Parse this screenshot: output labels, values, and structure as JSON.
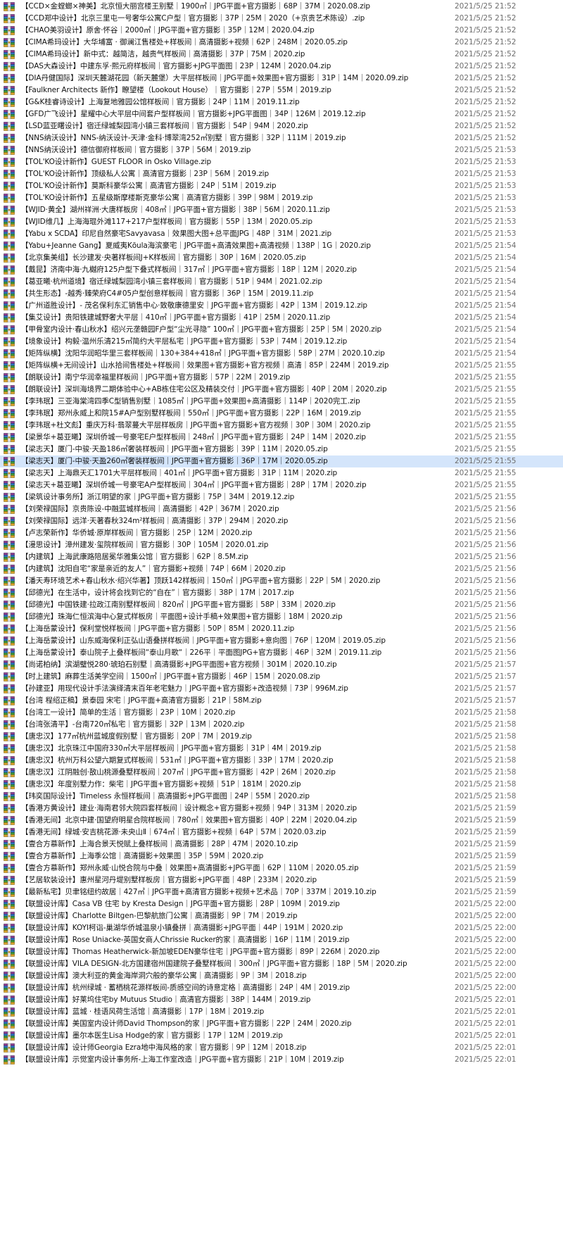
{
  "icon": "rar-archive-icon",
  "colors": {
    "selected_row": "#d4e5fb",
    "date_text": "#6d6d6d"
  },
  "selected_index": 38,
  "files": [
    {
      "name": "【CCD×金螳螂×神美】北京恒大丽宫楼王别墅｜1900㎡｜JPG平面+官方摄影｜68P｜37M｜2020.08.zip",
      "date": "2021/5/25 21:52"
    },
    {
      "name": "【CCD郑中设计】北京三里屯一号奢华公寓C户型｜官方摄影｜37P｜25M｜2020（+京贵艺术陈设）.zip",
      "date": "2021/5/25 21:52"
    },
    {
      "name": "【CHAO美羽设计】原舍·怀谷｜2000㎡｜JPG平面+官方摄影｜35P｜12M｜2020.04.zip",
      "date": "2021/5/25 21:52"
    },
    {
      "name": "【CIMA希玛设计】大华埔富 · 御澜江售楼处+样板间｜高清摄影+视频｜62P｜248M｜2020.05.zip",
      "date": "2021/5/25 21:52"
    },
    {
      "name": "【CIMA希玛设计】新中式：越简洁，越贵气样板间｜高清摄影｜37P｜75M｜2020.zip",
      "date": "2021/5/25 21:52"
    },
    {
      "name": "【DAS大森设计】中建东孚·熙元府样板间｜官方摄影+JPG平面图｜23P｜124M｜2020.04.zip",
      "date": "2021/5/25 21:52"
    },
    {
      "name": "【DIA丹健国际】深圳天麓湖花园（新天麓堡）大平层样板间｜JPG平面+效果图+官方摄影｜31P｜14M｜2020.09.zip",
      "date": "2021/5/25 21:52"
    },
    {
      "name": "【Faulkner Architects 新作】瞭望楼（Lookout House）｜官方摄影｜27P｜55M｜2019.zip",
      "date": "2021/5/25 21:52"
    },
    {
      "name": "【G&K桂睿诗设计】上海复地雅园公馆样板间｜官方摄影｜24P｜11M｜2019.11.zip",
      "date": "2021/5/25 21:52"
    },
    {
      "name": "【GFD广飞设计】星耀中心大平层中间套户型样板间｜官方摄影+JPG平面图｜34P｜126M｜2019.12.zip",
      "date": "2021/5/25 21:52"
    },
    {
      "name": "【LSD蓝亚曙设计】宿迁绿城梨园湾小镇三套样板间｜官方摄影｜54P｜94M｜2020.zip",
      "date": "2021/5/25 21:52"
    },
    {
      "name": "【NNS纳沃设计】NNS-纳沃设计-天津·金科·博翠湾252㎡别墅｜官方摄影｜32P｜111M｜2019.zip",
      "date": "2021/5/25 21:52"
    },
    {
      "name": "【NNS纳沃设计】德信御府样板间｜官方摄影｜37P｜56M｜2019.zip",
      "date": "2021/5/25 21:53"
    },
    {
      "name": "【TOL'KO设计新作】GUEST FLOOR in Osko Village.zip",
      "date": "2021/5/25 21:53"
    },
    {
      "name": "【TOL'KO设计新作】顶级私人公寓｜高清官方摄影｜23P｜56M｜2019.zip",
      "date": "2021/5/25 21:53"
    },
    {
      "name": "【TOL'KO设计新作】莫斯科豪华公寓｜高清官方摄影｜24P｜51M｜2019.zip",
      "date": "2021/5/25 21:53"
    },
    {
      "name": "【TOL'KO设计新作】五星级斯摩楼斯克豪华公寓｜高清官方摄影｜39P｜98M｜2019.zip",
      "date": "2021/5/25 21:53"
    },
    {
      "name": "【WJID·黄全】湖州祥洲·大唐样板房｜408㎡｜JPG平面+官方摄影｜38P｜56M｜2020.11.zip",
      "date": "2021/5/25 21:53"
    },
    {
      "name": "【WJID维几】上海海琨外滩117+217户型样板间｜官方摄影｜55P｜13M｜2020.05.zip",
      "date": "2021/5/25 21:53"
    },
    {
      "name": "【Yabu x SCDA】印尼自然豪宅Savyavasa｜效果图大图+总平面JPG｜48P｜31M｜2021.zip",
      "date": "2021/5/25 21:53"
    },
    {
      "name": "【Yabu+Jeanne Gang】夏威夷Kōula海滨豪宅｜JPG平面+高清效果图+高清视频｜138P｜1G｜2020.zip",
      "date": "2021/5/25 21:54"
    },
    {
      "name": "【北京集美组】长沙建发·央著样板间J+K样板间｜官方摄影｜30P｜16M｜2020.05.zip",
      "date": "2021/5/25 21:54"
    },
    {
      "name": "【戴昆】济南中海·九樾府125户型下叠式样板间｜317㎡｜JPG平面+官方摄影｜18P｜12M｜2020.zip",
      "date": "2021/5/25 21:54"
    },
    {
      "name": "【葛亚曦·杭州道境】宿迁绿城梨园湾小镇三套样板间｜官方摄影｜51P｜94M｜2021.02.zip",
      "date": "2021/5/25 21:54"
    },
    {
      "name": "【共生形态】-越秀·臻荣府C4#05户型创意样板间｜官方摄影｜36P｜15M｜2019.11.zip",
      "date": "2021/5/25 21:54"
    },
    {
      "name": "【广州道胜设计】- 茂名保利东汇销售中心·致敬康德里安｜JPG平面+官方摄影｜42P｜13M｜2019.12.zip",
      "date": "2021/5/25 21:54"
    },
    {
      "name": "【集艾设计】贵阳铁建城野奢大平层｜410㎡｜JPG平面+官方摄影｜41P｜25M｜2020.11.zip",
      "date": "2021/5/25 21:54"
    },
    {
      "name": "【甲骨室内设计·春山秋水】绍兴元垄赣园F户型“尘光寻隐” 100㎡｜JPG平面+官方摄影｜25P｜5M｜2020.zip",
      "date": "2021/5/25 21:54"
    },
    {
      "name": "【境象设计】构毅·温州乐清215㎡简约大平层私宅｜JPG平面+官方摄影｜53P｜74M｜2019.12.zip",
      "date": "2021/5/25 21:54"
    },
    {
      "name": "【矩阵纵横】沈阳华润昭华里三套样板间｜130+384+418㎡｜JPG平面+官方摄影｜58P｜27M｜2020.10.zip",
      "date": "2021/5/25 21:54"
    },
    {
      "name": "【矩阵纵横+无间设计】山水拾间售楼处+样板间｜效果图+官方摄影+官方视频｜高清｜85P｜224M｜2019.zip",
      "date": "2021/5/25 21:55"
    },
    {
      "name": "【朗联设计】南宁华润幸福里样板间｜JPG平面+官方摄影｜57P｜22M｜2019.zip",
      "date": "2021/5/25 21:55"
    },
    {
      "name": "【朗联设计】深圳海境界二期体验中心+AB栋住宅公区及精装交付｜JPG平面+官方摄影｜40P｜20M｜2020.zip",
      "date": "2021/5/25 21:55"
    },
    {
      "name": "【李玮珉】三亚海棠湾四季C型销售别墅｜1085㎡｜JPG平面+效果图+高清摄影｜114P｜2020完工.zip",
      "date": "2021/5/25 21:55"
    },
    {
      "name": "【李玮珉】郑州永威上和院15#A户型别墅样板间｜550㎡｜JPG平面+官方摄影｜22P｜16M｜2019.zip",
      "date": "2021/5/25 21:55"
    },
    {
      "name": "【李玮珉+杜文彪】重庆万科·翡翠蔓大平层样板房｜JPG平面+官方摄影+官方视频｜30P｜30M｜2020.zip",
      "date": "2021/5/25 21:55"
    },
    {
      "name": "【梁景华+葛亚曦】深圳侨城一号豪宅E户型样板间｜248㎡｜JPG平面+官方摄影｜24P｜14M｜2020.zip",
      "date": "2021/5/25 21:55"
    },
    {
      "name": "【梁志天】厦门-中骏·天盈186㎡奢装样板间｜JPG平面+官方摄影｜39P｜11M｜2020.05.zip",
      "date": "2021/5/25 21:55"
    },
    {
      "name": "【梁志天】厦门-中骏·天盈260㎡奢装样板间｜JPG平面+官方摄影｜36P｜17M｜2020.05.zip",
      "date": "2021/5/25 21:55"
    },
    {
      "name": "【梁志天】上海鼎天汇1701大平层样板间｜401㎡｜JPG平面+官方摄影｜31P｜11M｜2020.zip",
      "date": "2021/5/25 21:55"
    },
    {
      "name": "【梁志天+葛亚曦】深圳侨城一号豪宅A户型样板间｜304㎡｜JPG平面+官方摄影｜28P｜17M｜2020.zip",
      "date": "2021/5/25 21:55"
    },
    {
      "name": "【梁筑设计事务所】浙江明望的家｜JPG平面+官方摄影｜75P｜34M｜2019.12.zip",
      "date": "2021/5/25 21:55"
    },
    {
      "name": "【刘荣禄国际】京贵陈设-中融蓝城样板间｜高清摄影｜42P｜367M｜2020.zip",
      "date": "2021/5/25 21:56"
    },
    {
      "name": "【刘荣禄国际】远洋·天著春秋324m²样板间｜高清摄影｜37P｜294M｜2020.zip",
      "date": "2021/5/25 21:56"
    },
    {
      "name": "【卢志荣新作】华侨城·原岸样板间｜官方摄影｜25P｜12M｜2020.zip",
      "date": "2021/5/25 21:56"
    },
    {
      "name": "【漫思设计】漳州建发·玺院样板间｜官方摄影｜30P｜105M｜2020.01.zip",
      "date": "2021/5/25 21:56"
    },
    {
      "name": "【内建筑】上海武康路陪居冕华雅集公馆｜官方摄影｜62P｜8.5M.zip",
      "date": "2021/5/25 21:56"
    },
    {
      "name": "【内建筑】沈阳自宅“家是亲近的友人”｜官方摄影+视频｜74P｜66M｜2020.zip",
      "date": "2021/5/25 21:56"
    },
    {
      "name": "【潘天寿环境艺术+春山秋水·绍兴华著】顶跃142样板间｜150㎡｜JPG平面+官方摄影｜22P｜5M｜2020.zip",
      "date": "2021/5/25 21:56"
    },
    {
      "name": "【邱德光】在生活中，设计将会找到它的“自在”｜官方摄影｜38P｜17M｜2017.zip",
      "date": "2021/5/25 21:56"
    },
    {
      "name": "【邱德光】中国铁建·拉政江南别墅样板间｜820㎡｜JPG平面+官方摄影｜58P｜33M｜2020.zip",
      "date": "2021/5/25 21:56"
    },
    {
      "name": "【邱德光】珠海仁恒滨海中心复式样板房｜平面图+设计手稿+效果图+官方摄影｜18M｜2020.zip",
      "date": "2021/5/25 21:56"
    },
    {
      "name": "【上海岳蒙设计】保利堂悦样板间｜JPG平面+官方摄影｜50P｜85M｜2020.11.zip",
      "date": "2021/5/25 21:56"
    },
    {
      "name": "【上海岳蒙设计】山东威海保利正弘山语叠拼样板间｜JPG平面+官方摄影+意向图｜76P｜120M｜2019.05.zip",
      "date": "2021/5/25 21:56"
    },
    {
      "name": "【上海岳蒙设计】泰山院子上叠样板间“泰山月歌“｜226平｜平面图JPG+官方摄影｜46P｜32M｜2019.11.zip",
      "date": "2021/5/25 21:56"
    },
    {
      "name": "【尚诺柏纳】滨湖璧悦280·琥珀石别墅｜高清摄影+JPG平面图+官方视频｜301M｜2020.10.zip",
      "date": "2021/5/25 21:57"
    },
    {
      "name": "【时上建筑】麻葬生活美学空间｜1500㎡｜JPG平面+官方摄影｜46P｜15M｜2020.08.zip",
      "date": "2021/5/25 21:57"
    },
    {
      "name": "【孙建亚】用现代设计手法演绎清末百年老宅魅力｜JPG平面+官方摄影+改造视频｜73P｜996M.zip",
      "date": "2021/5/25 21:57"
    },
    {
      "name": "【台湾 程绍正稿】景泰园 宋宅｜JPG平面+高清官方摄影｜21P｜58M.zip",
      "date": "2021/5/25 21:57"
    },
    {
      "name": "【台湾工一设计】简单的生活｜官方摄影｜23P｜10M｜2020.zip",
      "date": "2021/5/25 21:58"
    },
    {
      "name": "【台湾张清平】-台南720㎡私宅｜官方摄影｜32P｜13M｜2020.zip",
      "date": "2021/5/25 21:58"
    },
    {
      "name": "【唐忠汉】177㎡杭州蓝城度假别墅｜官方摄影｜20P｜7M｜2019.zip",
      "date": "2021/5/25 21:58"
    },
    {
      "name": "【唐忠汉】北京珠江中国府330㎡大平层样板间｜JPG平面+官方摄影｜31P｜4M｜2019.zip",
      "date": "2021/5/25 21:58"
    },
    {
      "name": "【唐忠汉】杭州万科公望六期复式样板间｜531㎡｜JPG平面+官方摄影｜33P｜17M｜2020.zip",
      "date": "2021/5/25 21:58"
    },
    {
      "name": "【唐忠汉】江阴融创·敔山桃源叠墅样板间｜207㎡｜JPG平面+官方摄影｜42P｜26M｜2020.zip",
      "date": "2021/5/25 21:58"
    },
    {
      "name": "【唐忠汉】年度别墅力作：柴宅｜JPG平面+官方摄影+视频｜51P｜181M｜2020.zip",
      "date": "2021/5/25 21:58"
    },
    {
      "name": "【玮奕国际设计】Timeless 永恒样板间｜高清摄影+JPG平面图｜24P｜55M｜2020.zip",
      "date": "2021/5/25 21:58"
    },
    {
      "name": "【香港方黄设计】建业·海南君邻大院四套样板间｜设计概念+官方摄影+视频｜94P｜313M｜2020.zip",
      "date": "2021/5/25 21:59"
    },
    {
      "name": "【香港无间】北京中建·国望府明星合院样板间｜780㎡｜效果图+官方摄影｜40P｜22M｜2020.04.zip",
      "date": "2021/5/25 21:59"
    },
    {
      "name": "【香港无间】绿城·安吉桃花源·未央山Ⅱ｜674㎡｜官方摄影+视频｜64P｜57M｜2020.03.zip",
      "date": "2021/5/25 21:59"
    },
    {
      "name": "【壹合方慕新作】上海合景天悦赋上叠样板间｜高清摄影｜28P｜47M｜2020.10.zip",
      "date": "2021/5/25 21:59"
    },
    {
      "name": "【壹合方慕新作】上海季公馆｜高清摄影+效果图｜35P｜59M｜2020.zip",
      "date": "2021/5/25 21:59"
    },
    {
      "name": "【壹合方慕新作】郑州永威·山悦合院与中叠｜效果图+高清摄影+JPG平面｜62P｜110M｜2020.05.zip",
      "date": "2021/5/25 21:59"
    },
    {
      "name": "【艺居软装设计】惠州星河丹堤别墅样板房｜官方摄影+JPG平面｜48P｜233M｜2020.zip",
      "date": "2021/5/25 21:59"
    },
    {
      "name": "【最新私宅】贝聿铭纽约故居｜427㎡｜JPG平面+高清官方摄影+视频+艺术品｜70P｜337M｜2019.10.zip",
      "date": "2021/5/25 21:59"
    },
    {
      "name": "【联盟设计库】Casa VB 住宅 by Kresta Design｜JPG平面+官方摄影｜28P｜109M｜2019.zip",
      "date": "2021/5/25 22:00"
    },
    {
      "name": "【联盟设计库】Charlotte Biltgen-巴黎航旅门公寓｜高清摄影｜9P｜7M｜2019.zip",
      "date": "2021/5/25 22:00"
    },
    {
      "name": "【联盟设计库】KOYI柯诣-巢湖华侨城温泉小镇叠拼｜高清摄影+JPG平面｜44P｜191M｜2020.zip",
      "date": "2021/5/25 22:00"
    },
    {
      "name": "【联盟设计库】Rose Uniacke-英国女商人Chrissie Rucker的家｜高清摄影｜16P｜11M｜2019.zip",
      "date": "2021/5/25 22:00"
    },
    {
      "name": "【联盟设计库】Thomas Heatherwick-新加坡EDEN豪华住宅｜JPG平面+官方摄影｜89P｜226M｜2020.zip",
      "date": "2021/5/25 22:00"
    },
    {
      "name": "【联盟设计库】VILA DESIGN-北方国建宿州国建院子叠墅样板间｜300㎡｜JPG平面+官方摄影｜18P｜5M｜2020.zip",
      "date": "2021/5/25 22:00"
    },
    {
      "name": "【联盟设计库】澳大利亚的黄金海岸洞穴般的豪华公寓｜高清摄影｜9P｜3M｜2018.zip",
      "date": "2021/5/25 22:00"
    },
    {
      "name": "【联盟设计库】杭州绿城 · 蓄栖桃花源样板间-质感空间的诗意定格｜高清摄影｜24P｜4M｜2019.zip",
      "date": "2021/5/25 22:00"
    },
    {
      "name": "【联盟设计库】好莱坞住宅by Mutuus Studio｜高清官方摄影｜38P｜144M｜2019.zip",
      "date": "2021/5/25 22:01"
    },
    {
      "name": "【联盟设计库】蓝城 · 桂语风荷生活馆｜高清摄影｜17P｜18M｜2019.zip",
      "date": "2021/5/25 22:01"
    },
    {
      "name": "【联盟设计库】美国室内设计师David Thompson的家｜JPG平面+官方摄影｜22P｜24M｜2020.zip",
      "date": "2021/5/25 22:01"
    },
    {
      "name": "【联盟设计库】墨尔本医生Lisa Hodge的家｜官方摄影｜17P｜12M｜2019.zip",
      "date": "2021/5/25 22:01"
    },
    {
      "name": "【联盟设计库】设计师Georgia Ezra地中海风格的家｜官方摄影｜9P｜12M｜2018.zip",
      "date": "2021/5/25 22:01"
    },
    {
      "name": "【联盟设计库】示觉室内设计事务所-上海工作室改造｜JPG平面+官方摄影｜21P｜10M｜2019.zip",
      "date": "2021/5/25 22:01"
    }
  ]
}
